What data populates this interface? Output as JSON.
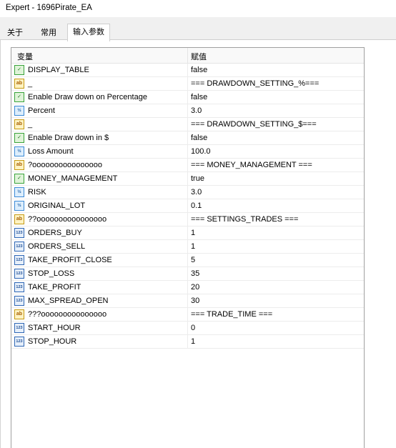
{
  "window": {
    "title": "Expert - 1696Pirate_EA"
  },
  "tabs": [
    {
      "label": "关于"
    },
    {
      "label": "常用"
    },
    {
      "label": "输入参数"
    }
  ],
  "table": {
    "headers": {
      "variable": "变量",
      "value": "赋值"
    },
    "rows": [
      {
        "type": "bool",
        "name": "DISPLAY_TABLE",
        "value": "false"
      },
      {
        "type": "string",
        "name": "_",
        "value": "=== DRAWDOWN_SETTING_%==="
      },
      {
        "type": "bool",
        "name": "Enable Draw down on Percentage",
        "value": "false"
      },
      {
        "type": "double",
        "name": "Percent",
        "value": "3.0"
      },
      {
        "type": "string",
        "name": "_",
        "value": "=== DRAWDOWN_SETTING_$==="
      },
      {
        "type": "bool",
        "name": "Enable Draw down in $",
        "value": "false"
      },
      {
        "type": "double",
        "name": "Loss Amount",
        "value": "100.0"
      },
      {
        "type": "string",
        "name": "?oooooooooooooooo",
        "value": "=== MONEY_MANAGEMENT ==="
      },
      {
        "type": "bool",
        "name": "MONEY_MANAGEMENT",
        "value": "true"
      },
      {
        "type": "double",
        "name": "RISK",
        "value": "3.0"
      },
      {
        "type": "double",
        "name": "ORIGINAL_LOT",
        "value": "0.1"
      },
      {
        "type": "string",
        "name": "??oooooooooooooooo",
        "value": "=== SETTINGS_TRADES ==="
      },
      {
        "type": "int",
        "name": "ORDERS_BUY",
        "value": "1"
      },
      {
        "type": "int",
        "name": "ORDERS_SELL",
        "value": "1"
      },
      {
        "type": "int",
        "name": "TAKE_PROFIT_CLOSE",
        "value": "5"
      },
      {
        "type": "int",
        "name": "STOP_LOSS",
        "value": "35"
      },
      {
        "type": "int",
        "name": "TAKE_PROFIT",
        "value": "20"
      },
      {
        "type": "int",
        "name": "MAX_SPREAD_OPEN",
        "value": "30"
      },
      {
        "type": "string",
        "name": "???ooooooooooooooo",
        "value": "=== TRADE_TIME ==="
      },
      {
        "type": "int",
        "name": "START_HOUR",
        "value": "0"
      },
      {
        "type": "int",
        "name": "STOP_HOUR",
        "value": "1"
      }
    ]
  },
  "type_icons": {
    "bool": {
      "icon": "bool-icon",
      "glyph": "✓"
    },
    "string": {
      "icon": "string-icon",
      "glyph": "ab"
    },
    "double": {
      "icon": "double-icon",
      "glyph": "½"
    },
    "int": {
      "icon": "int-icon",
      "glyph": "123"
    }
  }
}
